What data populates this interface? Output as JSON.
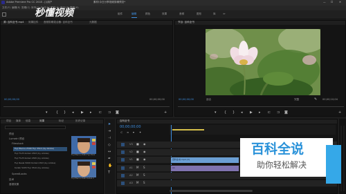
{
  "app": {
    "title": "Adobe Premiere Pro CC 2018 - [\\\\用户",
    "doc_title": "素材\\今日分享视频剪辑预览*",
    "logo_text": "秒懂视频",
    "menu": [
      "文件(F)",
      "编辑(E)",
      "剪辑(C)",
      "序列(S)",
      "标记(M)",
      "图形(G)",
      "窗口(W)",
      "帮助(H)"
    ]
  },
  "workspaces": [
    "组件",
    "编辑",
    "颜色",
    "效果",
    "音频",
    "图形",
    "库",
    "≫"
  ],
  "source_panel": {
    "tabs": [
      "源: 百科全书.mp4",
      "效果控件",
      "音频剪辑混合器: 百科全书",
      "元数据"
    ],
    "timecode_left": "00;00;00;00",
    "timecode_right": "00;00;00;00"
  },
  "program_panel": {
    "tab": "节目: 百科全书",
    "timecode_left": "00;00;00;00",
    "fit_label": "适合",
    "quality_label": "完整",
    "timecode_right": "00;00;10;04"
  },
  "project_panel": {
    "tabs": [
      "项目",
      "媒体",
      "信息",
      "效果",
      "标记",
      "历史记录"
    ],
    "items": [
      "预设",
      "Lumetri 预设",
      "Filmstock",
      "Fuji Eterna 250D Fuji 3510 (by Adobe)",
      "Fuji F125 Kodak 2393 (by Adobe)",
      "Fuji F125 Kodak 2395 (by Adobe)",
      "Fuji Reala 500D Kodak 2393 (by Adobe)",
      "Kodak 5205 Fuji 3510 (by Adobe)",
      "SpeedLooks",
      "技术",
      "音频效果"
    ],
    "thumb_captions": [
      "Fuji Eterna 250D Fuji 3510",
      "Fuji Eterna 250D Kodak 2"
    ]
  },
  "timeline": {
    "tab": "百科全书",
    "timecode": "00;00;00;00",
    "tracks_video": [
      "V3",
      "V2",
      "V1"
    ],
    "tracks_audio": [
      "A1",
      "A2",
      "A3"
    ],
    "video_clip_label": "百科全书.mp4 [V]",
    "audio_clip_label": "A1"
  },
  "watermark": {
    "title": "百科全说",
    "subtitle": "助你轻松解决"
  },
  "colors": {
    "accent": "#3f8fe0",
    "timeline_yellow": "#d6c04a",
    "clip_blue": "#5a8fc4",
    "watermark_bg": "#35a8e8"
  }
}
